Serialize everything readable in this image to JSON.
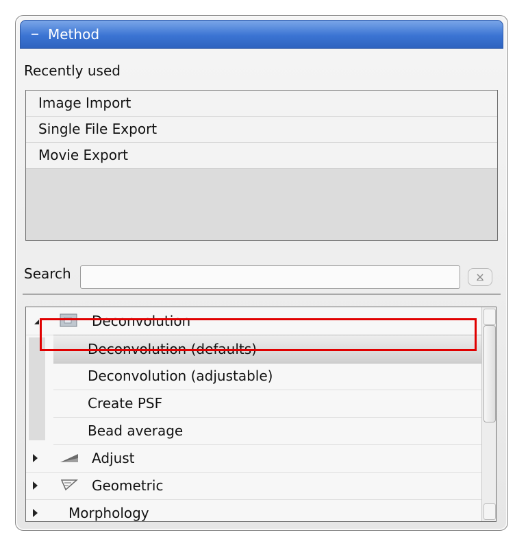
{
  "header": {
    "title": "Method"
  },
  "recent": {
    "label": "Recently used",
    "items": [
      "Image Import",
      "Single File Export",
      "Movie Export"
    ]
  },
  "search": {
    "label": "Search",
    "value": "",
    "placeholder": ""
  },
  "tree": {
    "categories": [
      {
        "label": "Deconvolution",
        "expanded": true,
        "children": [
          "Deconvolution (defaults)",
          "Deconvolution (adjustable)",
          "Create PSF",
          "Bead average"
        ],
        "selected": "Deconvolution (defaults)"
      },
      {
        "label": "Adjust",
        "expanded": false
      },
      {
        "label": "Geometric",
        "expanded": false
      },
      {
        "label": "Morphology",
        "expanded": false
      }
    ]
  },
  "colors": {
    "header": "#3b74d3",
    "highlight": "#e00000"
  }
}
